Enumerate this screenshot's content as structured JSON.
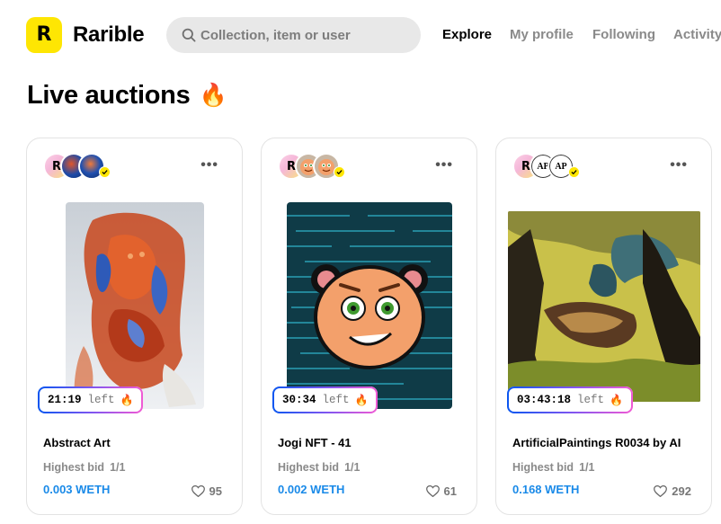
{
  "header": {
    "brand": "Rarible",
    "logo_letter": "R",
    "search_placeholder": "Collection, item or user",
    "nav": [
      "Explore",
      "My profile",
      "Following",
      "Activity"
    ]
  },
  "section": {
    "title": "Live auctions",
    "title_emoji": "🔥"
  },
  "colors": {
    "brand_yellow": "#fee603",
    "bid_blue": "#1a8ae8",
    "timer_gradient": [
      "#0a56f0",
      "#7b55f1",
      "#f15ad4"
    ]
  },
  "cards": [
    {
      "name": "Abstract Art",
      "timer": "21:19",
      "timer_suffix": "left",
      "bid_label": "Highest bid",
      "quantity": "1/1",
      "bid": "0.003 WETH",
      "likes": "95",
      "icons": [
        "more-icon",
        "heart-icon",
        "fire-icon"
      ]
    },
    {
      "name": "Jogi NFT - 41",
      "timer": "30:34",
      "timer_suffix": "left",
      "bid_label": "Highest bid",
      "quantity": "1/1",
      "bid": "0.002 WETH",
      "likes": "61",
      "icons": [
        "more-icon",
        "heart-icon",
        "fire-icon"
      ]
    },
    {
      "name": "ArtificialPaintings R0034 by AI",
      "timer": "03:43:18",
      "timer_suffix": "left",
      "bid_label": "Highest bid",
      "quantity": "1/1",
      "bid": "0.168 WETH",
      "likes": "292",
      "avatar_text": "AP",
      "icons": [
        "more-icon",
        "heart-icon",
        "fire-icon"
      ]
    }
  ]
}
